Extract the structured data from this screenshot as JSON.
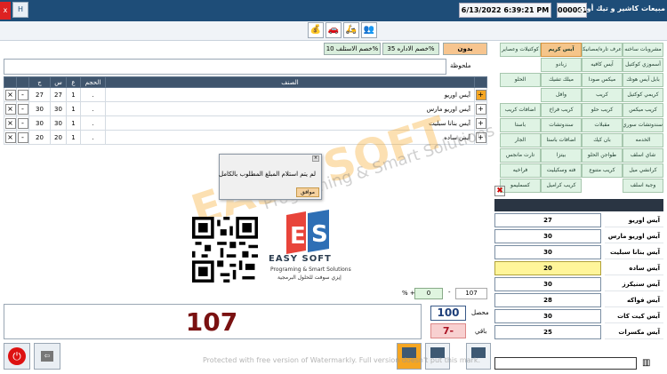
{
  "titlebar": {
    "app_title": "مبيعات كاشير و تيك أواي",
    "datetime": "6/13/2022 6:39:21 PM",
    "invoice_no": "000001",
    "h_label": "H",
    "close_label": "x"
  },
  "toolbar": {
    "icons": [
      "group-icon",
      "delivery-icon",
      "car-icon",
      "cash-bag-icon"
    ]
  },
  "discounts": {
    "none": "بدون",
    "admin35": "خصم الاداره 35%",
    "outlet10": "خصم الاستلف 10%"
  },
  "note_label": "ملحوظة",
  "table": {
    "headers": [
      "الصنف",
      "الحجم",
      "ع",
      "س",
      "ج",
      "",
      "",
      ""
    ],
    "rows": [
      {
        "name": "آيس اوريو",
        "size": ".",
        "qty": "1",
        "price": "27",
        "total": "27"
      },
      {
        "name": "آيس اوريو مارس",
        "size": ".",
        "qty": "1",
        "price": "30",
        "total": "30"
      },
      {
        "name": "آيس بنانا سبليت",
        "size": ".",
        "qty": "1",
        "price": "30",
        "total": "30"
      },
      {
        "name": "آيس ساده",
        "size": ".",
        "qty": "1",
        "price": "20",
        "total": "20"
      }
    ]
  },
  "dialog": {
    "message": "لم يتم استلام المبلغ المطلوب بالكامل",
    "ok": "موافق"
  },
  "watermark": {
    "main": "EASY SOFT",
    "sub": "Programing & Smart Solutions"
  },
  "logo": {
    "name": "EASY SOFT",
    "sub1": "Programing & Smart Solutions",
    "sub2": "إيزي سوفت للحلول البرمجية"
  },
  "totals": {
    "pct_label": "% +",
    "pct_value": "0",
    "dash": "-",
    "discount_value": "107",
    "total": "107",
    "paid_label": "محصل",
    "paid": "100",
    "remain_label": "باقي",
    "remain": "7-"
  },
  "bottom": {
    "protect_note": "Protected with free version of Watermarkly. Full version doesn't put this mark."
  },
  "categories": [
    [
      "مشروبات ساخنه",
      "عرف تاره/مصانيكا",
      "آيس كريم",
      "كوكتيلات وعصاير"
    ],
    [
      "أسموزي كوكتيل",
      "آيس كافيه",
      "زبادو",
      ""
    ],
    [
      "بابل آيس هوتك",
      "ميكس صودا",
      "ميلك تشيك",
      "الحلو"
    ],
    [
      "كريمي كوكتيل",
      "كريب",
      "وافل",
      ""
    ],
    [
      "كريب ميكس",
      "كريب حلو",
      "كريب فراخ",
      "اضافات كريب"
    ],
    [
      "سندوتشات سوري",
      "مقبلات",
      "سندوتشات",
      "باستا"
    ],
    [
      "الخدمه",
      "بان كيك",
      "اضافات باستا",
      "الجار"
    ],
    [
      "شاي اسلف",
      "طواجن الحلو",
      "بيتزا",
      "تارت مانجس"
    ],
    [
      "كرانشي ميل",
      "كريب متنوع",
      "فته وسكيليت",
      "فراخيه"
    ],
    [
      "وجبة اسلف",
      "",
      "كريب كراميل",
      "كسمليمو"
    ]
  ],
  "products": [
    {
      "name": "آيس اوريو",
      "price": "27"
    },
    {
      "name": "آيس اوريو مارس",
      "price": "30"
    },
    {
      "name": "آيس بنانا سبليت",
      "price": "30"
    },
    {
      "name": "آيس ساده",
      "price": "20"
    },
    {
      "name": "آيس سنيكرز",
      "price": "30"
    },
    {
      "name": "آيس فواكه",
      "price": "28"
    },
    {
      "name": "آيس كيت كات",
      "price": "30"
    },
    {
      "name": "آيس مكسرات",
      "price": "25"
    }
  ]
}
